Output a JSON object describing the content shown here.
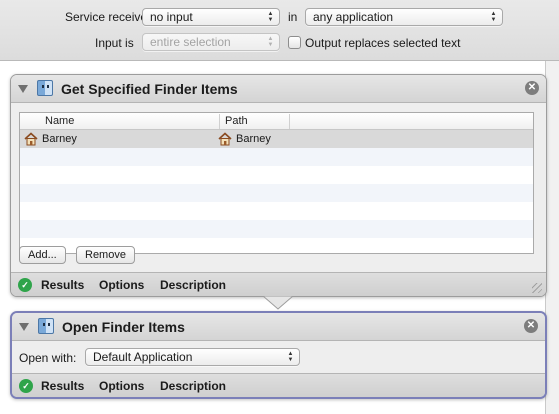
{
  "service": {
    "receives_label": "Service receives",
    "receives_value": "no input",
    "in_label": "in",
    "in_value": "any application",
    "input_is_label": "Input is",
    "input_is_value": "entire selection",
    "output_replaces_label": "Output replaces selected text"
  },
  "action1": {
    "title": "Get Specified Finder Items",
    "columns": [
      "Name",
      "Path"
    ],
    "rows": [
      {
        "name": "Barney",
        "path": "Barney"
      }
    ],
    "add_label": "Add...",
    "remove_label": "Remove",
    "tabs": [
      "Results",
      "Options",
      "Description"
    ]
  },
  "action2": {
    "title": "Open Finder Items",
    "open_with_label": "Open with:",
    "open_with_value": "Default Application",
    "tabs": [
      "Results",
      "Options",
      "Description"
    ]
  },
  "icons": {
    "action_icon": "finder-icon",
    "item_icon": "home-icon",
    "close": "close-icon",
    "status": "check-icon"
  },
  "colors": {
    "selected_border": "#7b7fb8",
    "status_green": "#2fa44a"
  }
}
